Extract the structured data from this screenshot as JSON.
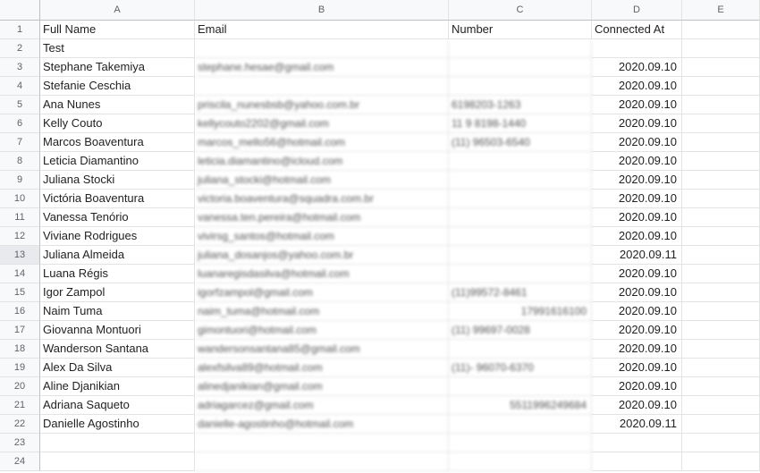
{
  "columns": [
    "A",
    "B",
    "C",
    "D",
    "E"
  ],
  "rows": [
    {
      "n": "1",
      "a": "Full Name",
      "b": "Email",
      "c": "Number",
      "d": "Connected At"
    },
    {
      "n": "2",
      "a": "Test",
      "b": "",
      "c": "",
      "d": ""
    },
    {
      "n": "3",
      "a": "Stephane Takemiya",
      "b": "stephane.hesae@gmail.com",
      "c": "",
      "d": "2020.09.10"
    },
    {
      "n": "4",
      "a": "Stefanie Ceschia",
      "b": "",
      "c": "",
      "d": "2020.09.10"
    },
    {
      "n": "5",
      "a": "Ana Nunes",
      "b": "priscila_nunesbsb@yahoo.com.br",
      "c": "6198203-1263",
      "d": "2020.09.10"
    },
    {
      "n": "6",
      "a": "Kelly Couto",
      "b": "kellycouto2202@gmail.com",
      "c": "11 9 8198-1440",
      "d": "2020.09.10"
    },
    {
      "n": "7",
      "a": "Marcos Boaventura",
      "b": "marcos_mello56@hotmail.com",
      "c": "(11) 96503-6540",
      "d": "2020.09.10"
    },
    {
      "n": "8",
      "a": "Leticia Diamantino",
      "b": "leticia.diamantino@icloud.com",
      "c": "",
      "d": "2020.09.10"
    },
    {
      "n": "9",
      "a": "Juliana Stocki",
      "b": "juliana_stocki@hotmail.com",
      "c": "",
      "d": "2020.09.10"
    },
    {
      "n": "10",
      "a": "Victória Boaventura",
      "b": "victoria.boaventura@squadra.com.br",
      "c": "",
      "d": "2020.09.10"
    },
    {
      "n": "11",
      "a": "Vanessa Tenório",
      "b": "vanessa.ten.pereira@hotmail.com",
      "c": "",
      "d": "2020.09.10"
    },
    {
      "n": "12",
      "a": "Viviane Rodrigues",
      "b": "vivirsg_santos@hotmail.com",
      "c": "",
      "d": "2020.09.10"
    },
    {
      "n": "13",
      "a": "Juliana Almeida",
      "b": "juliana_dosanjos@yahoo.com.br",
      "c": "",
      "d": "2020.09.11"
    },
    {
      "n": "14",
      "a": "Luana Régis",
      "b": "luanaregisdasilva@hotmail.com",
      "c": "",
      "d": "2020.09.10"
    },
    {
      "n": "15",
      "a": "Igor Zampol",
      "b": "igorfzampol@gmail.com",
      "c": "(11)99572-8461",
      "d": "2020.09.10"
    },
    {
      "n": "16",
      "a": "Naim Tuma",
      "b": "naim_tuma@hotmail.com",
      "c": "17991616100",
      "d": "2020.09.10"
    },
    {
      "n": "17",
      "a": "Giovanna Montuori",
      "b": "gimontuori@hotmail.com",
      "c": "(11) 99697-0028",
      "d": "2020.09.10"
    },
    {
      "n": "18",
      "a": "Wanderson Santana",
      "b": "wandersonsantana85@gmail.com",
      "c": "",
      "d": "2020.09.10"
    },
    {
      "n": "19",
      "a": "Alex Da Silva",
      "b": "alexfsilva89@hotmail.com",
      "c": "(11)-  96070-6370",
      "d": "2020.09.10"
    },
    {
      "n": "20",
      "a": "Aline Djanikian",
      "b": "alinedjanikian@gmail.com",
      "c": "",
      "d": "2020.09.10"
    },
    {
      "n": "21",
      "a": "Adriana Saqueto",
      "b": "adriagarcez@gmail.com",
      "c": "5511996249684",
      "d": "2020.09.10"
    },
    {
      "n": "22",
      "a": "Danielle Agostinho",
      "b": "danielle-agostinho@hotmail.com",
      "c": "",
      "d": "2020.09.11"
    },
    {
      "n": "23",
      "a": "",
      "b": "",
      "c": "",
      "d": ""
    },
    {
      "n": "24",
      "a": "",
      "b": "",
      "c": "",
      "d": ""
    }
  ]
}
